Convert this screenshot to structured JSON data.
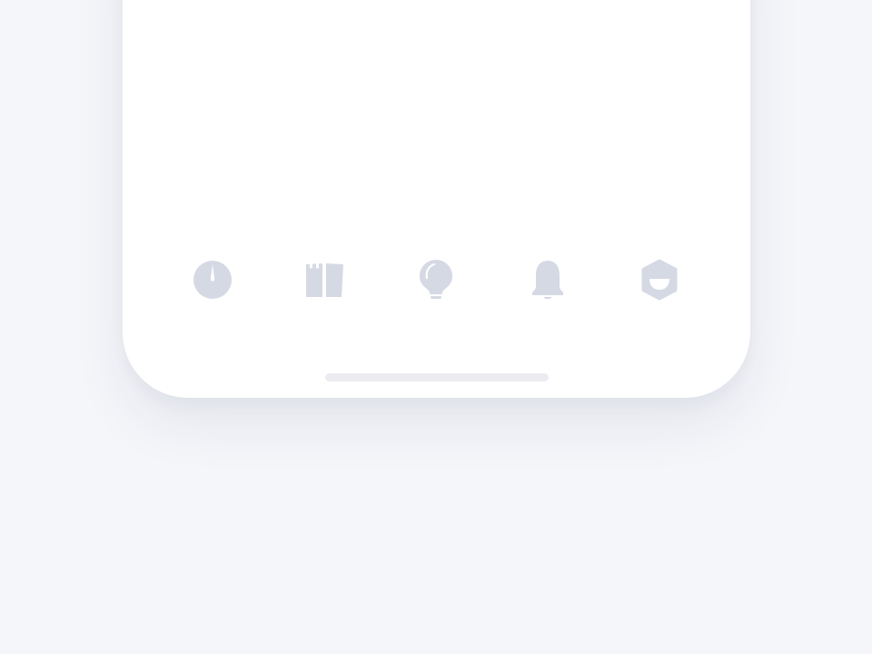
{
  "colors": {
    "background": "#f5f6fa",
    "card": "#ffffff",
    "icon": "#d5d9e4",
    "home_indicator": "#ecebf1"
  },
  "tabbar": {
    "items": [
      {
        "icon": "gauge-icon",
        "label": ""
      },
      {
        "icon": "book-icon",
        "label": ""
      },
      {
        "icon": "lightbulb-icon",
        "label": ""
      },
      {
        "icon": "bell-icon",
        "label": ""
      },
      {
        "icon": "face-icon",
        "label": ""
      }
    ],
    "selected_index": null
  }
}
